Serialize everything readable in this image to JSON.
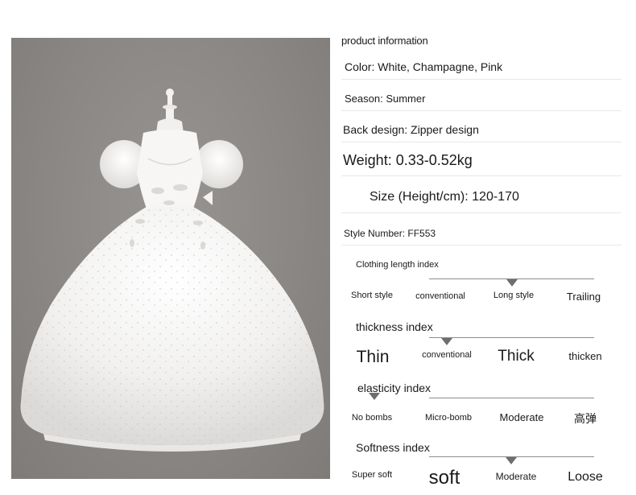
{
  "product": {
    "heading": "product information",
    "color": "Color: White, Champagne, Pink",
    "season": "Season: Summer",
    "back_design": "Back design: Zipper design",
    "weight": "Weight: 0.33-0.52kg",
    "size": "Size (Height/cm): 120-170",
    "style_number": "Style Number: FF553"
  },
  "indices": [
    {
      "title": "Clothing length index",
      "labels": [
        "Short style",
        "conventional",
        "Long style",
        "Trailing"
      ],
      "selected": 2
    },
    {
      "title": "thickness index",
      "labels": [
        "Thin",
        "conventional",
        "Thick",
        "thicken"
      ],
      "selected": 1
    },
    {
      "title": "elasticity index",
      "labels": [
        "No bombs",
        "Micro-bomb",
        "Moderate",
        "高弹"
      ],
      "selected": 0
    },
    {
      "title": "Softness index",
      "labels": [
        "Super soft",
        "soft",
        "Moderate",
        "Loose"
      ],
      "selected": 2
    }
  ],
  "photo": {
    "subject": "white-ball-gown-dress-image",
    "background_color": "#8a8784"
  }
}
